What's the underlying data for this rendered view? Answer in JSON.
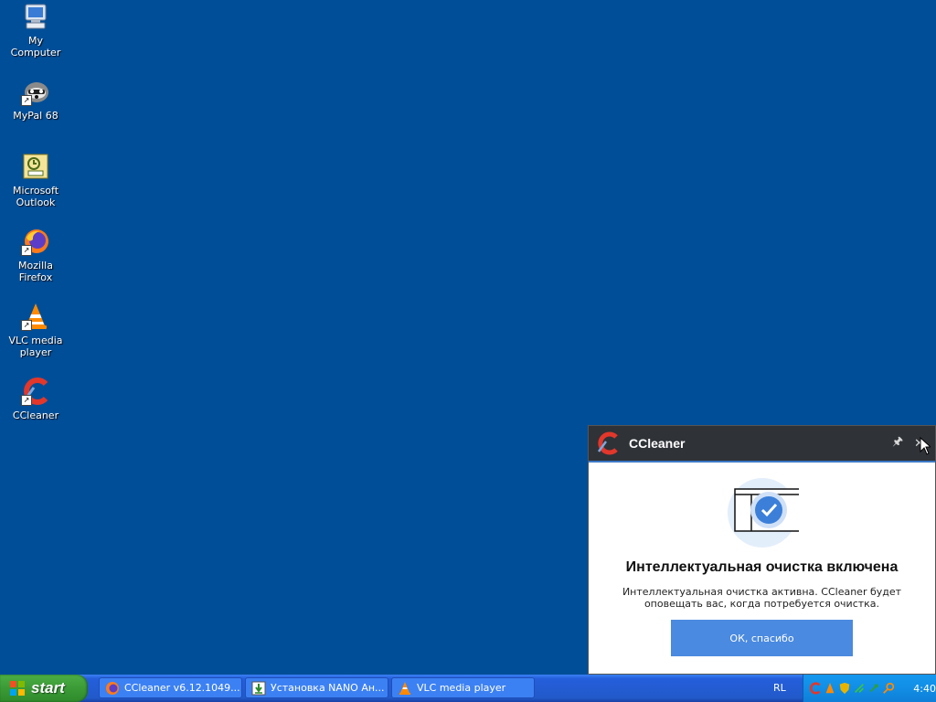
{
  "desktop": {
    "icons": [
      {
        "label": "My Computer",
        "icon": "my-computer-icon"
      },
      {
        "label": "MyPal 68",
        "icon": "mypal-icon"
      },
      {
        "label": "Microsoft Outlook",
        "icon": "outlook-icon"
      },
      {
        "label": "Mozilla Firefox",
        "icon": "firefox-icon"
      },
      {
        "label": "VLC media player",
        "icon": "vlc-icon"
      },
      {
        "label": "CCleaner",
        "icon": "ccleaner-icon"
      }
    ]
  },
  "popup": {
    "title": "CCleaner",
    "pin_glyph": "🖈",
    "close_glyph": "✕",
    "headline": "Интеллектуальная очистка включена",
    "message": "Интеллектуальная очистка активна. CCleaner будет оповещать вас, когда потребуется очистка.",
    "ok_label": "ОК, спасибо"
  },
  "taskbar": {
    "start_label": "start",
    "tasks": [
      {
        "label": "CCleaner v6.12.1049...",
        "icon": "firefox-icon"
      },
      {
        "label": "Установка NANO Ан...",
        "icon": "download-icon"
      },
      {
        "label": "VLC media player",
        "icon": "vlc-icon"
      }
    ],
    "language": "RL",
    "clock": "4:40"
  },
  "colors": {
    "desktop_bg": "#004e98",
    "popup_titlebar": "#2f3237",
    "ok_button": "#4a8ae0",
    "taskbar": "#245edb",
    "start_green": "#3b9a36"
  }
}
